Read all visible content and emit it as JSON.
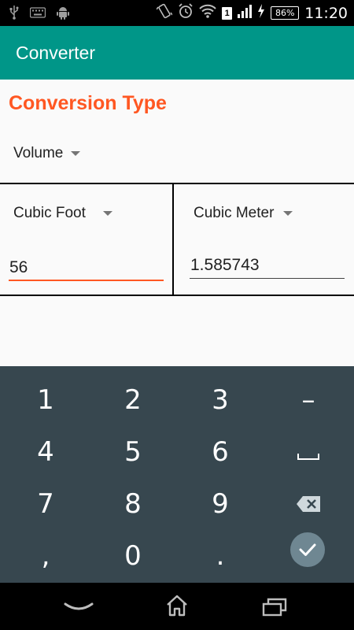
{
  "status_bar": {
    "left_icons": [
      "usb-icon",
      "keyboard-icon",
      "android-icon"
    ],
    "right_icons": [
      "vibrate-icon",
      "alarm-icon",
      "wifi-icon",
      "sim-icon",
      "signal-icon",
      "charging-icon"
    ],
    "sim_label": "1",
    "battery_level": "86%",
    "time": "11:20"
  },
  "app_bar": {
    "title": "Converter",
    "color": "#009688"
  },
  "conversion": {
    "section_title": "Conversion Type",
    "type_selected": "Volume",
    "from_unit": "Cubic Foot",
    "from_value": "56",
    "to_unit": "Cubic Meter",
    "to_value": "1.585743",
    "accent_color": "#ff5722"
  },
  "keypad": {
    "rows": [
      [
        "1",
        "2",
        "3",
        "–"
      ],
      [
        "4",
        "5",
        "6",
        "space-icon"
      ],
      [
        "7",
        "8",
        "9",
        "backspace-icon"
      ],
      [
        ",",
        "0",
        ".",
        "done-icon"
      ]
    ]
  },
  "nav_bar": {
    "icons": [
      "hide-keyboard-icon",
      "home-icon",
      "recent-apps-icon"
    ]
  }
}
